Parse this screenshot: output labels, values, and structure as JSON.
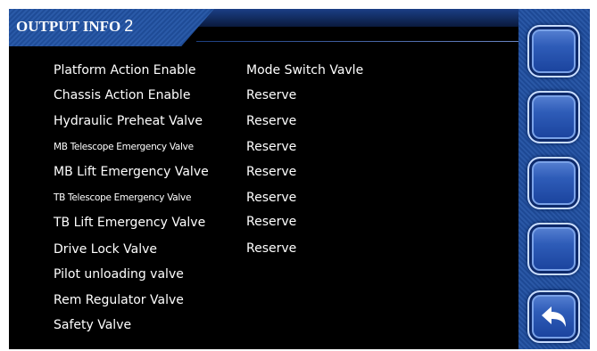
{
  "header": {
    "title": "OUTPUT INFO",
    "page": "2"
  },
  "rows": [
    {
      "label": "Platform Action Enable",
      "value": "Mode Switch Vavle"
    },
    {
      "label": "Chassis Action Enable",
      "value": "Reserve"
    },
    {
      "label": "Hydraulic Preheat Valve",
      "value": "Reserve"
    },
    {
      "label": "MB Telescope Emergency Valve",
      "value": "Reserve"
    },
    {
      "label": "MB Lift Emergency Valve",
      "value": "Reserve"
    },
    {
      "label": "TB Telescope Emergency Valve",
      "value": "Reserve"
    },
    {
      "label": "TB Lift Emergency Valve",
      "value": "Reserve"
    },
    {
      "label": "Drive Lock Valve",
      "value": "Reserve"
    },
    {
      "label": "Pilot unloading valve",
      "value": ""
    },
    {
      "label": "Rem Regulator Valve",
      "value": ""
    },
    {
      "label": "Safety Valve",
      "value": ""
    }
  ],
  "side_buttons": {
    "back_icon": "back-arrow-icon",
    "colors": {
      "panel": "#2a58a6",
      "button": "#2e5cb8",
      "accent": "#c8dcff"
    }
  }
}
